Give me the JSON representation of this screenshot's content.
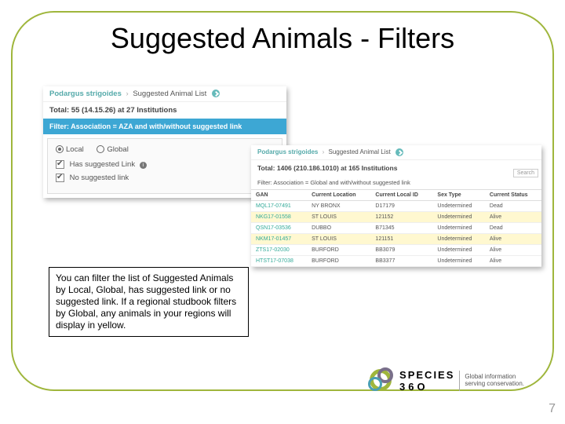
{
  "title": "Suggested Animals - Filters",
  "page_number": "7",
  "caption": "You can filter the list of Suggested Animals by Local, Global, has suggested link or no suggested link. If a regional studbook filters by Global, any animals in your regions will display in yellow.",
  "left": {
    "breadcrumb_species": "Podargus strigoides",
    "breadcrumb_page": "Suggested Animal List",
    "total": "Total: 55 (14.15.26) at 27 Institutions",
    "filter_bar": "Filter: Association = AZA and with/without suggested link",
    "radio_local": "Local",
    "radio_global": "Global",
    "check1": "Has suggested Link",
    "check2": "No suggested link"
  },
  "right": {
    "breadcrumb_species": "Podargus strigoides",
    "breadcrumb_page": "Suggested Animal List",
    "total": "Total: 1406 (210.186.1010) at 165 Institutions",
    "filter_text": "Filter: Association = Global and with/without suggested link",
    "search_placeholder": "Search",
    "columns": [
      "GAN",
      "Current Location",
      "Current Local ID",
      "Sex Type",
      "Current Status"
    ],
    "rows": [
      {
        "gan": "MQL17-07491",
        "loc": "NY BRONX",
        "id": "D17179",
        "sex": "Undetermined",
        "status": "Dead",
        "hl": false
      },
      {
        "gan": "NKG17-01558",
        "loc": "ST LOUIS",
        "id": "121152",
        "sex": "Undetermined",
        "status": "Alive",
        "hl": true
      },
      {
        "gan": "QSN17-03536",
        "loc": "DUBBO",
        "id": "B71345",
        "sex": "Undetermined",
        "status": "Dead",
        "hl": false
      },
      {
        "gan": "NKM17-01457",
        "loc": "ST LOUIS",
        "id": "121151",
        "sex": "Undetermined",
        "status": "Alive",
        "hl": true
      },
      {
        "gan": "ZTS17-02030",
        "loc": "BURFORD",
        "id": "BB3079",
        "sex": "Undetermined",
        "status": "Alive",
        "hl": false
      },
      {
        "gan": "HTST17-07038",
        "loc": "BURFORD",
        "id": "BB3377",
        "sex": "Undetermined",
        "status": "Alive",
        "hl": false
      }
    ]
  },
  "logo": {
    "brand": "SPECIES",
    "brand2": "36O",
    "tagline1": "Global information",
    "tagline2": "serving conservation."
  }
}
